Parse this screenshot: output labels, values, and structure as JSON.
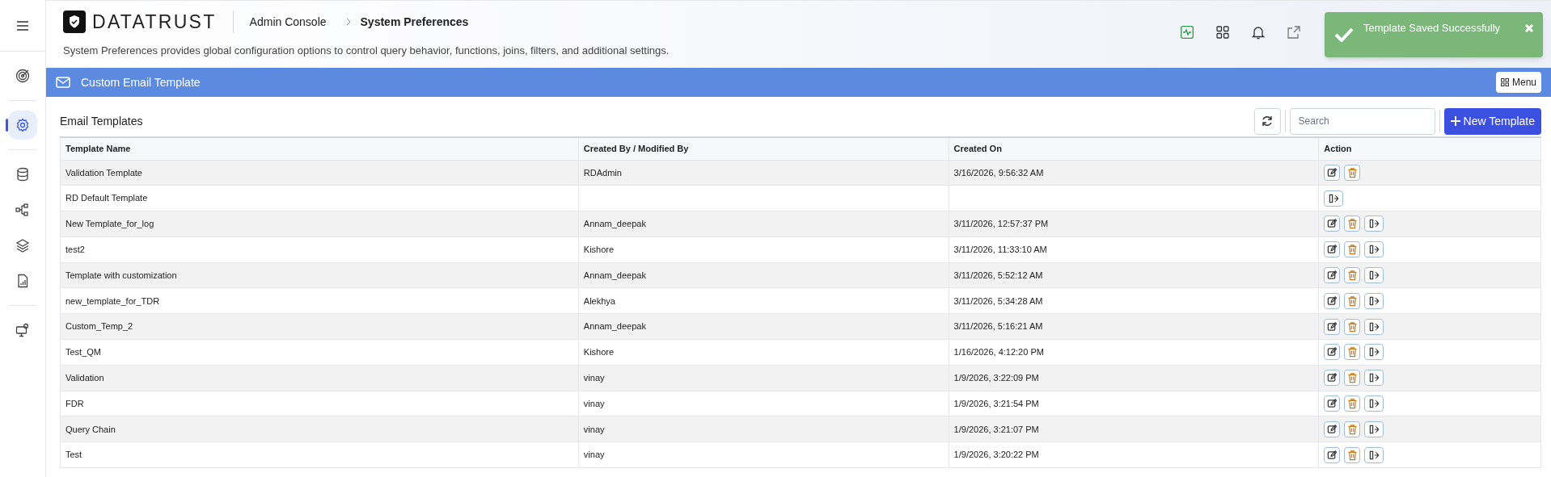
{
  "header": {
    "brand": "DATATRUST",
    "breadcrumb": [
      "Admin Console",
      "System Preferences"
    ],
    "description": "System Preferences provides global configuration options to control query behavior, functions, joins, filters, and additional settings."
  },
  "sidebar": {
    "items": [
      {
        "selected": false
      },
      {
        "selected": true
      },
      {
        "selected": false
      },
      {
        "selected": false
      },
      {
        "selected": false
      },
      {
        "selected": false
      },
      {
        "selected": false
      }
    ]
  },
  "toast": {
    "message": "Template Saved Successfully"
  },
  "section": {
    "title": "Custom Email Template",
    "menu_button": "Menu"
  },
  "panel": {
    "title": "Email Templates",
    "search": {
      "placeholder": "Search"
    },
    "new_button": "New Template"
  },
  "table": {
    "columns": [
      "Template Name",
      "Created By / Modified By",
      "Created On",
      "Action"
    ],
    "rows": [
      {
        "name": "Validation Template",
        "by": "RDAdmin",
        "on": "3/16/2026, 9:56:32 AM",
        "actions": [
          {
            "kind": "edit"
          },
          {
            "kind": "delete"
          }
        ]
      },
      {
        "name": "RD Default Template",
        "actions": [
          {
            "kind": "share"
          }
        ]
      },
      {
        "name": "New Template_for_log",
        "by": "Annam_deepak",
        "on": "3/11/2026, 12:57:37 PM",
        "actions": [
          {
            "kind": "edit"
          },
          {
            "kind": "delete"
          },
          {
            "kind": "share"
          }
        ]
      },
      {
        "name": "test2",
        "by": "Kishore",
        "on": "3/11/2026, 11:33:10 AM",
        "actions": [
          {
            "kind": "edit"
          },
          {
            "kind": "delete"
          },
          {
            "kind": "share"
          }
        ]
      },
      {
        "name": "Template with customization",
        "by": "Annam_deepak",
        "on": "3/11/2026, 5:52:12 AM",
        "actions": [
          {
            "kind": "edit"
          },
          {
            "kind": "delete"
          },
          {
            "kind": "share"
          }
        ]
      },
      {
        "name": "new_template_for_TDR",
        "by": "Alekhya",
        "on": "3/11/2026, 5:34:28 AM",
        "actions": [
          {
            "kind": "edit"
          },
          {
            "kind": "delete"
          },
          {
            "kind": "share"
          }
        ]
      },
      {
        "name": "Custom_Temp_2",
        "by": "Annam_deepak",
        "on": "3/11/2026, 5:16:21 AM",
        "actions": [
          {
            "kind": "edit"
          },
          {
            "kind": "delete"
          },
          {
            "kind": "share"
          }
        ]
      },
      {
        "name": "Test_QM",
        "by": "Kishore",
        "on": "1/16/2026, 4:12:20 PM",
        "actions": [
          {
            "kind": "edit"
          },
          {
            "kind": "delete"
          },
          {
            "kind": "share"
          }
        ]
      },
      {
        "name": "Validation",
        "by": "vinay",
        "on": "1/9/2026, 3:22:09 PM",
        "actions": [
          {
            "kind": "edit"
          },
          {
            "kind": "delete"
          },
          {
            "kind": "share"
          }
        ]
      },
      {
        "name": "FDR",
        "by": "vinay",
        "on": "1/9/2026, 3:21:54 PM",
        "actions": [
          {
            "kind": "edit"
          },
          {
            "kind": "delete"
          },
          {
            "kind": "share"
          }
        ]
      },
      {
        "name": "Query Chain",
        "by": "vinay",
        "on": "1/9/2026, 3:21:07 PM",
        "actions": [
          {
            "kind": "edit"
          },
          {
            "kind": "delete"
          },
          {
            "kind": "share"
          }
        ]
      },
      {
        "name": "Test",
        "by": "vinay",
        "on": "1/9/2026, 3:20:22 PM",
        "actions": [
          {
            "kind": "edit"
          },
          {
            "kind": "delete"
          },
          {
            "kind": "share"
          }
        ]
      }
    ]
  }
}
